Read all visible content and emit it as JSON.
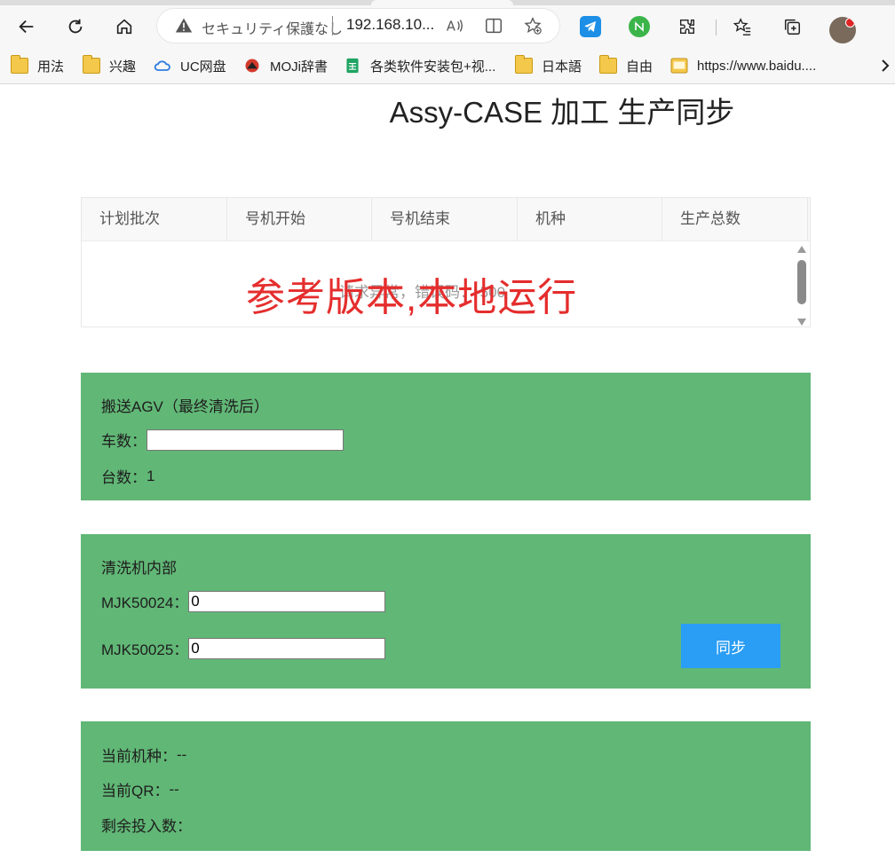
{
  "browser": {
    "security_text": "セキュリティ保護なし",
    "url": "192.168.10...",
    "bookmarks": [
      {
        "label": "用法",
        "icon": "folder-icon"
      },
      {
        "label": "兴趣",
        "icon": "folder-icon"
      },
      {
        "label": "UC网盘",
        "icon": "cloud-icon"
      },
      {
        "label": "MOJi辞書",
        "icon": "moji-icon"
      },
      {
        "label": "各类软件安装包+视...",
        "icon": "sheet-icon"
      },
      {
        "label": "日本語",
        "icon": "folder-icon"
      },
      {
        "label": "自由",
        "icon": "folder-icon"
      },
      {
        "label": "https://www.baidu....",
        "icon": "web-icon"
      }
    ]
  },
  "page": {
    "title": "Assy-CASE 加工 生产同步"
  },
  "table": {
    "columns": [
      "计划批次",
      "号机开始",
      "号机结束",
      "机种",
      "生产总数"
    ],
    "empty_text": "请求异常，错误码：-500",
    "watermark": "参考版本,本地运行"
  },
  "agv_panel": {
    "title": "搬送AGV（最终清洗后）",
    "cars_label": "车数：",
    "cars_value": "",
    "units_label": "台数：",
    "units_value": "1"
  },
  "washer_panel": {
    "title": "清洗机内部",
    "field1_label": "MJK50024：",
    "field1_value": "0",
    "field2_label": "MJK50025：",
    "field2_value": "0",
    "sync_button": "同步"
  },
  "status_panel": {
    "model_label": "当前机种：",
    "model_value": "--",
    "qr_label": "当前QR：",
    "qr_value": "--",
    "remaining_label": "剩余投入数：",
    "remaining_value": ""
  }
}
